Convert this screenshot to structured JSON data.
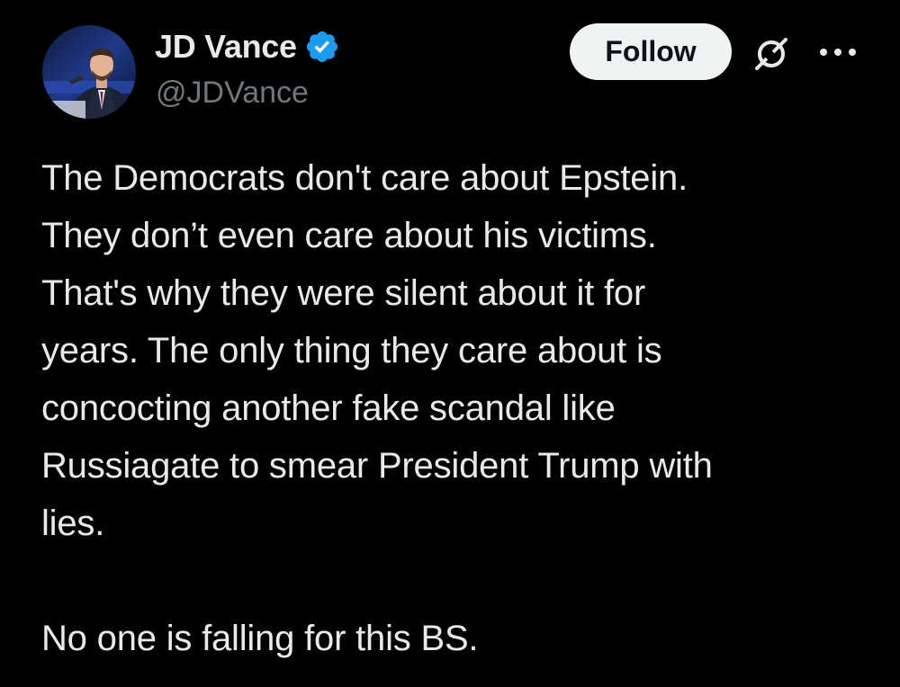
{
  "author": {
    "display_name": "JD Vance",
    "handle": "@JDVance",
    "verified": true,
    "verified_icon": "verified-badge-icon",
    "avatar_icon": "profile-photo"
  },
  "actions": {
    "follow_label": "Follow",
    "grok_icon": "grok-icon",
    "more_icon": "more-options-icon"
  },
  "tweet": {
    "paragraph1": "The Democrats don't care about Epstein.\nThey don’t even care about his victims.\nThat's why they were silent about it for\nyears. The only thing they care about is\nconcocting another fake scandal like\nRussiagate to smear President Trump with\nlies.",
    "paragraph2": "No one is falling for this BS."
  },
  "colors": {
    "background": "#000000",
    "text_primary": "#e7e9ea",
    "text_secondary": "#71767b",
    "follow_bg": "#eff3f4",
    "verified_blue": "#1d9bf0"
  }
}
